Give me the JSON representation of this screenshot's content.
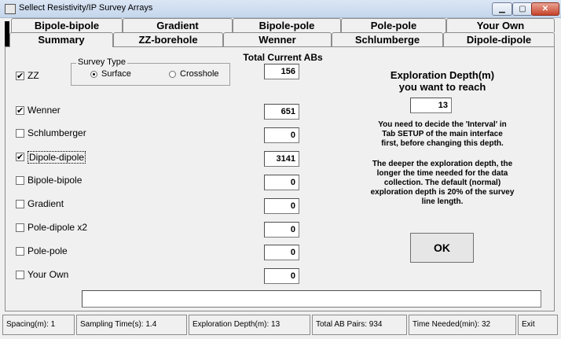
{
  "window": {
    "title": "Sellect Resistivity/IP Survey Arrays",
    "min_label": "▁",
    "max_label": "▢",
    "close_label": "✕"
  },
  "tabs": {
    "back_row": [
      "Bipole-bipole",
      "Gradient",
      "Bipole-pole",
      "Pole-pole",
      "Your Own"
    ],
    "front_row": [
      "Summary",
      "ZZ-borehole",
      "Wenner",
      "Schlumberge",
      "Dipole-dipole"
    ],
    "active": "Summary"
  },
  "total_current_label": "Total Current ABs",
  "survey_type": {
    "legend": "Survey Type",
    "options": [
      {
        "label": "Surface",
        "selected": true
      },
      {
        "label": "Crosshole",
        "selected": false
      }
    ]
  },
  "arrays": [
    {
      "label": "ZZ",
      "checked": true,
      "value": "156"
    },
    {
      "label": "Wenner",
      "checked": true,
      "value": "651"
    },
    {
      "label": "Schlumberger",
      "checked": false,
      "value": "0"
    },
    {
      "label": "Dipole-dipole",
      "checked": true,
      "value": "3141"
    },
    {
      "label": "Bipole-bipole",
      "checked": false,
      "value": "0"
    },
    {
      "label": "Gradient",
      "checked": false,
      "value": "0"
    },
    {
      "label": "Pole-dipole x2",
      "checked": false,
      "value": "0"
    },
    {
      "label": "Pole-pole",
      "checked": false,
      "value": "0"
    },
    {
      "label": "Your Own",
      "checked": false,
      "value": "0"
    }
  ],
  "exploration": {
    "heading_line1": "Exploration Depth(m)",
    "heading_line2": "you want to reach",
    "depth": "13",
    "note1": [
      "You need to decide the 'Interval' in",
      "Tab SETUP of the main interface",
      "first, before changing this depth."
    ],
    "note2": [
      "The deeper the exploration depth, the",
      "longer the time needed for the data",
      "collection.   The default (normal)",
      "exploration depth is 20% of the survey",
      "line length."
    ]
  },
  "ok_label": "OK",
  "bottom_text": "",
  "status": [
    "Spacing(m): 1",
    "Sampling Time(s): 1.4",
    "Exploration Depth(m): 13",
    "Total AB Pairs: 934",
    "Time Needed(min): 32",
    "Exit"
  ]
}
